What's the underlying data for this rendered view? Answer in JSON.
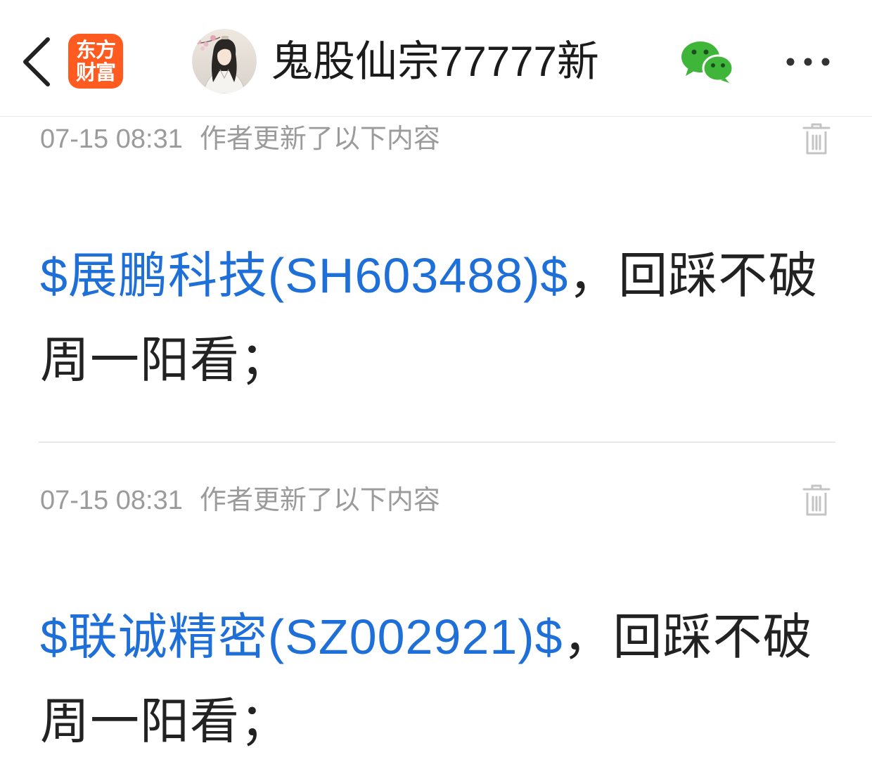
{
  "header": {
    "back_icon": "chevron-left-icon",
    "logo": {
      "line1": "东方",
      "line2": "财富",
      "icon": "eastmoney-logo"
    },
    "avatar_icon": "user-avatar",
    "title": "鬼股仙宗77777新",
    "share_icon": "wechat-icon",
    "more_icon": "more-horizontal-icon"
  },
  "posts": [
    {
      "time": "07-15 08:31",
      "update_note": "作者更新了以下内容",
      "delete_icon": "trash-icon",
      "stock_tag": "$展鹏科技(SH603488)$",
      "text_line1": "，回踩不破",
      "text_line2": "周一阳看；"
    },
    {
      "time": "07-15 08:31",
      "update_note": "作者更新了以下内容",
      "delete_icon": "trash-icon",
      "stock_tag": "$联诚精密(SZ002921)$",
      "text_line1": "，回踩不破",
      "text_line2": "周一阳看；"
    }
  ],
  "colors": {
    "brand_orange": "#FF5A1F",
    "link_blue": "#1F6FD8",
    "wechat_green": "#3FB63A",
    "text": "#222222",
    "meta_gray": "#9B9B9B"
  }
}
